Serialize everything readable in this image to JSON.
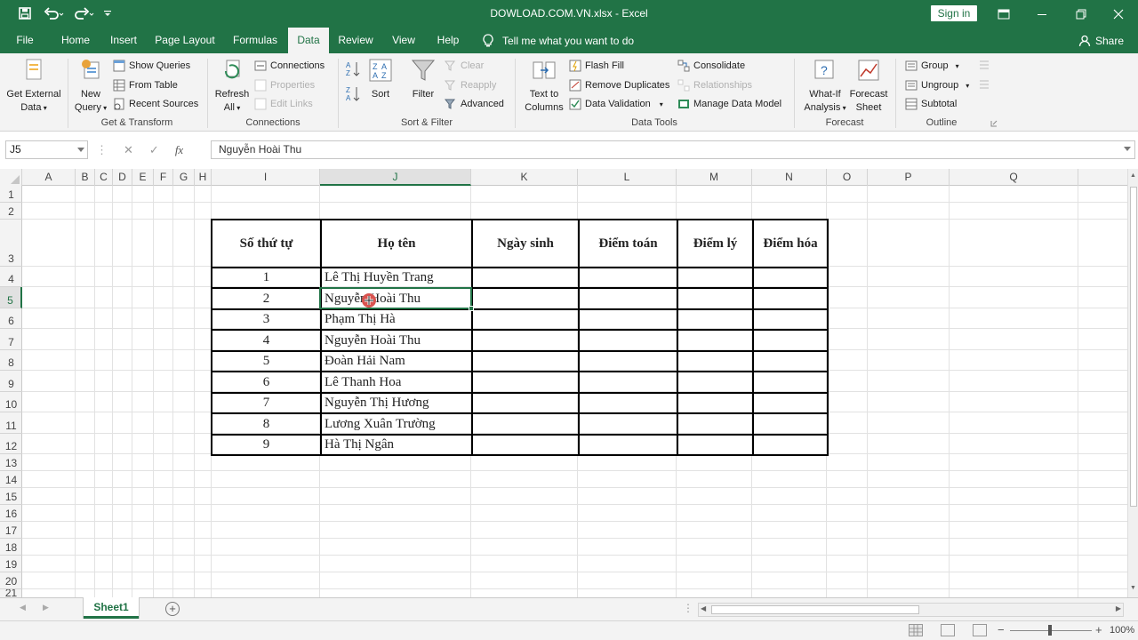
{
  "window": {
    "title": "DOWLOAD.COM.VN.xlsx  -  Excel",
    "sign_in": "Sign in"
  },
  "tabs": [
    "File",
    "Home",
    "Insert",
    "Page Layout",
    "Formulas",
    "Data",
    "Review",
    "View",
    "Help"
  ],
  "active_tab": "Data",
  "tell_me": "Tell me what you want to do",
  "share": "Share",
  "ribbon": {
    "get_external_data": [
      "Get External",
      "Data"
    ],
    "new_query": [
      "New",
      "Query"
    ],
    "show_queries": "Show Queries",
    "from_table": "From Table",
    "recent_sources": "Recent Sources",
    "group_get_transform": "Get & Transform",
    "refresh_all": [
      "Refresh",
      "All"
    ],
    "connections": "Connections",
    "properties": "Properties",
    "edit_links": "Edit Links",
    "group_connections": "Connections",
    "sort": "Sort",
    "filter": "Filter",
    "clear": "Clear",
    "reapply": "Reapply",
    "advanced": "Advanced",
    "group_sort_filter": "Sort & Filter",
    "text_to_columns": [
      "Text to",
      "Columns"
    ],
    "flash_fill": "Flash Fill",
    "remove_duplicates": "Remove Duplicates",
    "data_validation": "Data Validation",
    "consolidate": "Consolidate",
    "relationships": "Relationships",
    "manage_data_model": "Manage Data Model",
    "group_data_tools": "Data Tools",
    "what_if": [
      "What-If",
      "Analysis"
    ],
    "forecast_sheet": [
      "Forecast",
      "Sheet"
    ],
    "group_forecast": "Forecast",
    "group_btn": "Group",
    "ungroup": "Ungroup",
    "subtotal": "Subtotal",
    "group_outline": "Outline"
  },
  "formula_bar": {
    "name_box": "J5",
    "content": "Nguyễn Hoài Thu"
  },
  "columns": [
    "A",
    "B",
    "C",
    "D",
    "E",
    "F",
    "G",
    "H",
    "I",
    "J",
    "K",
    "L",
    "M",
    "N",
    "O",
    "P",
    "Q"
  ],
  "selected_column": "J",
  "rows": [
    "1",
    "2",
    "3",
    "4",
    "5",
    "6",
    "7",
    "8",
    "9",
    "10",
    "11",
    "12",
    "13",
    "14",
    "15",
    "16",
    "17",
    "18",
    "19",
    "20",
    "21"
  ],
  "selected_row": "5",
  "table": {
    "headers": [
      "Số thứ tự",
      "Họ tên",
      "Ngày sinh",
      "Điểm toán",
      "Điểm lý",
      "Điểm hóa"
    ],
    "rows": [
      {
        "stt": "1",
        "name": "Lê Thị Huyền Trang"
      },
      {
        "stt": "2",
        "name": "Nguyễn Hoài Thu"
      },
      {
        "stt": "3",
        "name": "Phạm Thị Hà"
      },
      {
        "stt": "4",
        "name": "Nguyễn Hoài Thu"
      },
      {
        "stt": "5",
        "name": "Đoàn Hải Nam"
      },
      {
        "stt": "6",
        "name": "Lê Thanh Hoa"
      },
      {
        "stt": "7",
        "name": "Nguyễn Thị Hương"
      },
      {
        "stt": "8",
        "name": "Lương Xuân Trường"
      },
      {
        "stt": "9",
        "name": "Hà Thị Ngân"
      }
    ]
  },
  "sheet_tab": "Sheet1",
  "zoom": "100%",
  "colors": {
    "excel_green": "#217346",
    "ribbon_bg": "#f3f3f3"
  }
}
